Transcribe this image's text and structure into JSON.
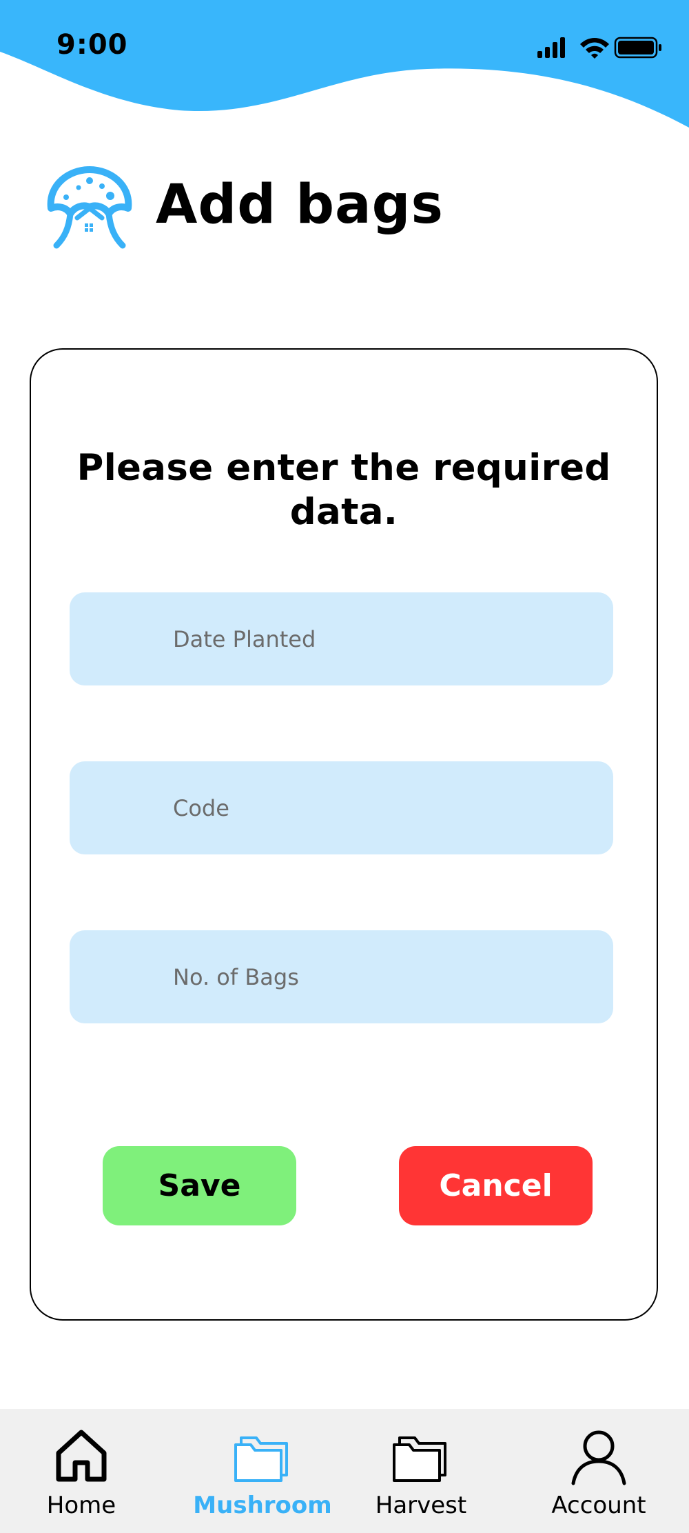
{
  "status_bar": {
    "time": "9:00",
    "icons": [
      "cellular-signal-icon",
      "wifi-icon",
      "battery-icon"
    ]
  },
  "header": {
    "title": "Add bags",
    "logo_icon": "mushroom-house-logo-icon"
  },
  "form": {
    "instructions": "Please enter the required data.",
    "fields": {
      "date_planted": {
        "placeholder": "Date Planted",
        "value": ""
      },
      "code": {
        "placeholder": "Code",
        "value": ""
      },
      "bags": {
        "placeholder": "No. of Bags",
        "value": ""
      }
    },
    "save_label": "Save",
    "cancel_label": "Cancel"
  },
  "nav": {
    "items": [
      {
        "label": "Home",
        "icon": "home-icon",
        "active": false
      },
      {
        "label": "Mushroom",
        "icon": "folder-icon",
        "active": true
      },
      {
        "label": "Harvest",
        "icon": "folders-icon",
        "active": false
      },
      {
        "label": "Account",
        "icon": "user-icon",
        "active": false
      }
    ]
  },
  "colors": {
    "accent": "#39b1f7",
    "field_bg": "#d1ebfc",
    "save": "#7ff07b",
    "cancel": "#ff3535",
    "nav_bg": "#f0f0f0"
  }
}
